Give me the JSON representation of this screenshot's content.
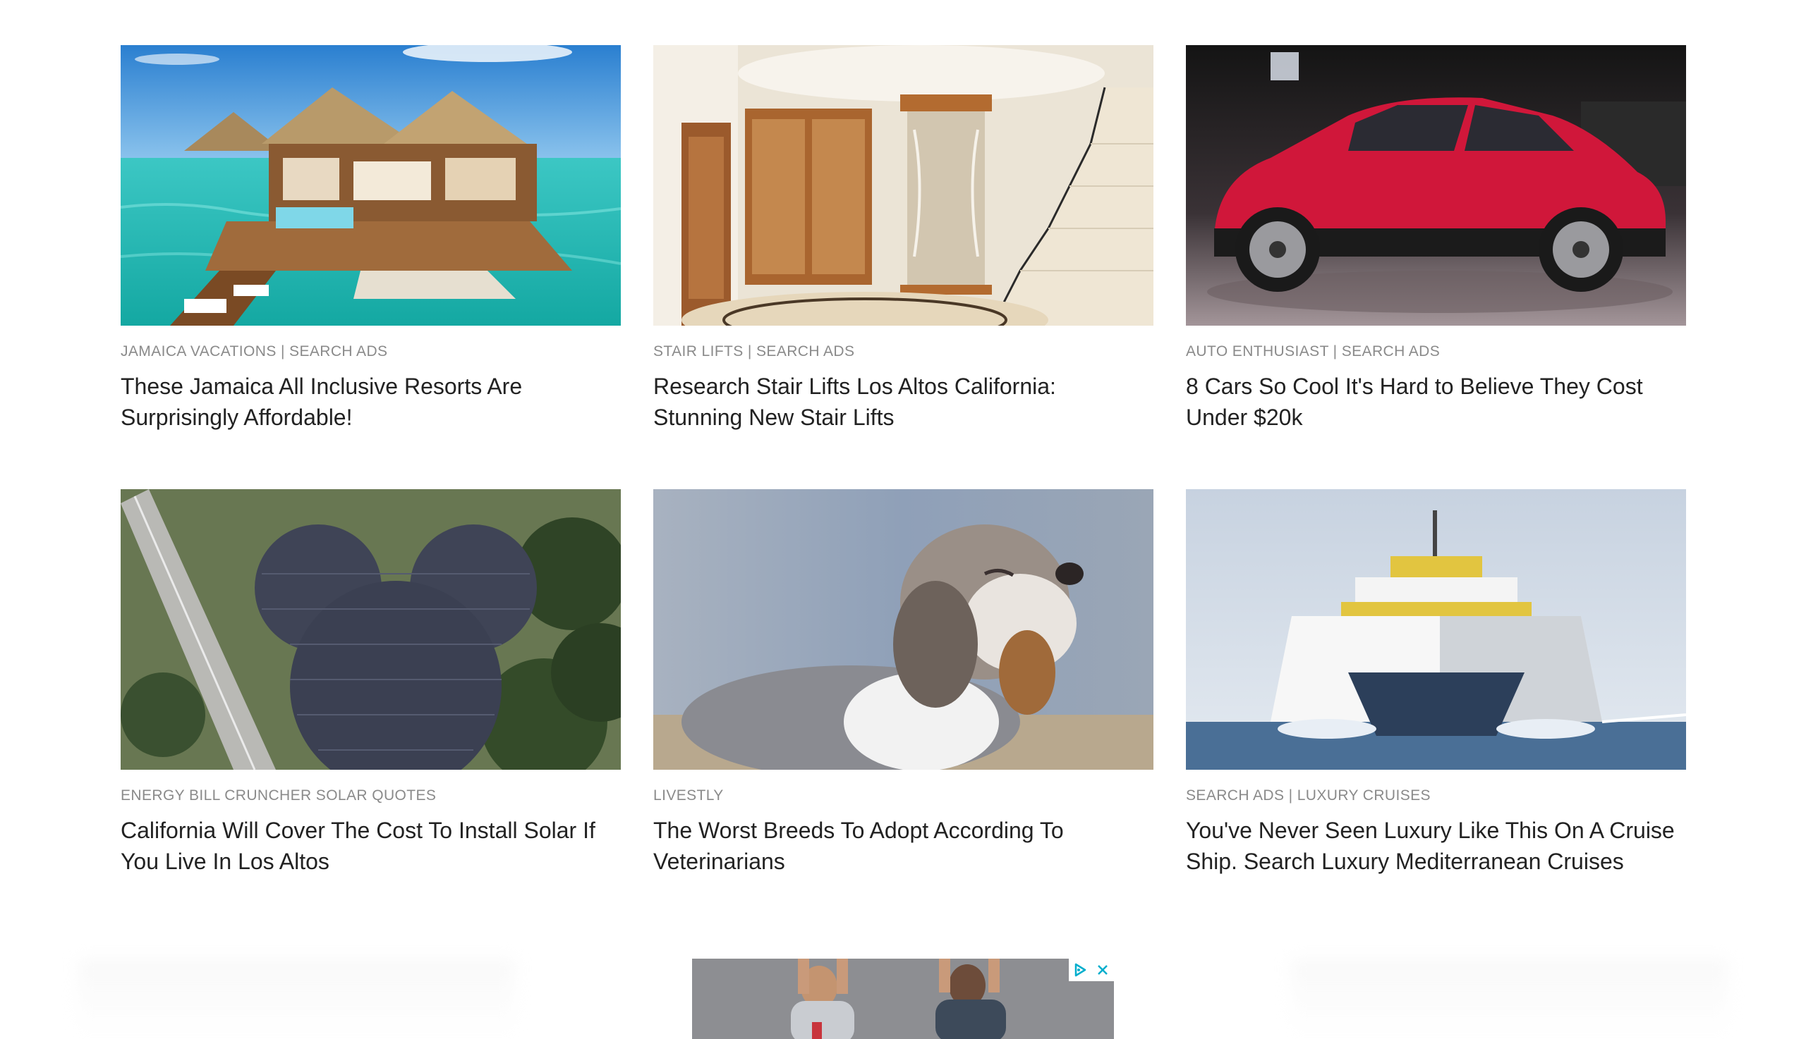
{
  "cards": [
    {
      "source": "JAMAICA VACATIONS | SEARCH ADS",
      "title": "These Jamaica All Inclusive Resorts Are Surprisingly Affordable!",
      "image": "overwater-bungalow-photo"
    },
    {
      "source": "STAIR LIFTS | SEARCH ADS",
      "title": "Research Stair Lifts Los Altos California: Stunning New Stair Lifts",
      "image": "home-elevator-staircase-photo"
    },
    {
      "source": "AUTO ENTHUSIAST | SEARCH ADS",
      "title": "8 Cars So Cool It's Hard to Believe They Cost Under $20k",
      "image": "red-suv-photo"
    },
    {
      "source": "ENERGY BILL CRUNCHER SOLAR QUOTES",
      "title": "California Will Cover The Cost To Install Solar If You Live In Los Altos",
      "image": "solar-farm-aerial-photo"
    },
    {
      "source": "LIVESTLY",
      "title": "The Worst Breeds To Adopt According To Veterinarians",
      "image": "puppy-photo"
    },
    {
      "source": "SEARCH ADS | LUXURY CRUISES",
      "title": "You've Never Seen Luxury Like This On A Cruise Ship. Search Luxury Mediterranean Cruises",
      "image": "catamaran-ship-photo"
    }
  ],
  "ad": {
    "adchoices_icon": "adchoices-icon",
    "close_icon": "close-icon",
    "adchoices_color": "#00aecd"
  }
}
